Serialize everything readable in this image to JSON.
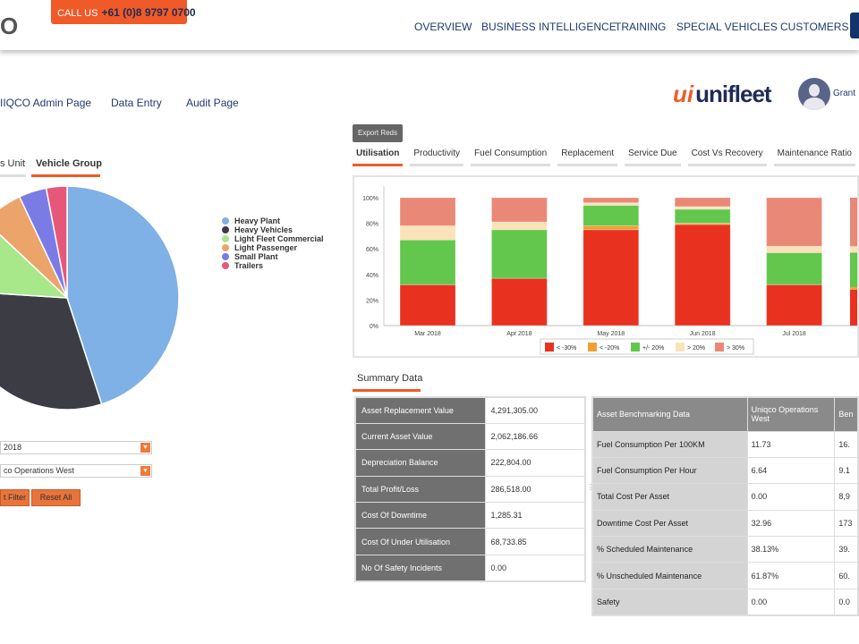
{
  "header": {
    "logo": "O",
    "call_label": "CALL US",
    "phone": "+61 (0)8 9797 0700",
    "nav": [
      "OVERVIEW",
      "BUSINESS INTELLIGENCE",
      "TRAINING",
      "SPECIAL VEHICLES",
      "CUSTOMERS"
    ]
  },
  "sublinks": [
    "IIQCO Admin Page",
    "Data Entry",
    "Audit Page"
  ],
  "brand": {
    "logo": "unifleet",
    "user": "Grant"
  },
  "left_tabs": [
    {
      "label": "s Unit",
      "active": false
    },
    {
      "label": "Vehicle Group",
      "active": true
    }
  ],
  "pie": {
    "type": "pie",
    "slices": [
      {
        "label": "Heavy Plant",
        "value": 45,
        "color": "#7fb0e6"
      },
      {
        "label": "Heavy Vehicles",
        "value": 31,
        "color": "#3c3c44"
      },
      {
        "label": "Light Fleet Commercial",
        "value": 11,
        "color": "#a8e88a"
      },
      {
        "label": "Light Passenger",
        "value": 6,
        "color": "#eca46a"
      },
      {
        "label": "Small Plant",
        "value": 4,
        "color": "#7b7be6"
      },
      {
        "label": "Trailers",
        "value": 3,
        "color": "#e6587a"
      }
    ]
  },
  "filters": {
    "date_value": "2018",
    "group_value": "co Operations West",
    "apply_label": "t Filter",
    "reset_label": "Reset All"
  },
  "export_label": "Export Reds",
  "chart_tabs": [
    {
      "label": "Utilisation",
      "active": true
    },
    {
      "label": "Productivity"
    },
    {
      "label": "Fuel Consumption"
    },
    {
      "label": "Replacement"
    },
    {
      "label": "Service Due"
    },
    {
      "label": "Cost Vs Recovery"
    },
    {
      "label": "Maintenance Ratio"
    }
  ],
  "chart_data": {
    "type": "bar",
    "stacked": true,
    "categories": [
      "Mar 2018",
      "Apr 2018",
      "May 2018",
      "Jun 2018",
      "Jul 2018"
    ],
    "ylim": [
      0,
      100
    ],
    "yticks": [
      "0%",
      "20%",
      "40%",
      "60%",
      "80%",
      "100%"
    ],
    "legend_position": "bottom",
    "series": [
      {
        "name": "< -30%",
        "color": "#e8321f",
        "values": [
          32,
          37,
          75,
          79,
          32
        ]
      },
      {
        "name": "< -20%",
        "color": "#f0a030",
        "values": [
          0,
          0,
          3,
          1,
          0
        ]
      },
      {
        "name": "+/- 20%",
        "color": "#62c74c",
        "values": [
          35,
          38,
          16,
          11,
          25
        ]
      },
      {
        "name": "> 20%",
        "color": "#fbe2b8",
        "values": [
          11,
          6,
          2,
          2,
          5
        ]
      },
      {
        "name": "> 30%",
        "color": "#ea8878",
        "values": [
          22,
          19,
          4,
          7,
          38
        ]
      }
    ]
  },
  "summary": {
    "tab": "Summary Data",
    "rows": [
      [
        "Asset Replacement Value",
        "4,291,305.00"
      ],
      [
        "Current Asset Value",
        "2,062,186.66"
      ],
      [
        "Depreciation Balance",
        "222,804.00"
      ],
      [
        "Total Profit/Loss",
        "286,518.00"
      ],
      [
        "Cost Of Downtime",
        "1,285.31"
      ],
      [
        "Cost Of Under Utilisation",
        "68,733.85"
      ],
      [
        "No Of Safety Incidents",
        "0.00"
      ]
    ]
  },
  "bench": {
    "headers": [
      "Asset Benchmarking Data",
      "Uniqco Operations West",
      "Ben"
    ],
    "rows": [
      [
        "Fuel Consumption Per 100KM",
        "11.73",
        "16."
      ],
      [
        "Fuel Consumption Per Hour",
        "6.64",
        "9.1"
      ],
      [
        "Total Cost Per Asset",
        "0.00",
        "8,9"
      ],
      [
        "Downtime Cost Per Asset",
        "32.96",
        "173"
      ],
      [
        "% Scheduled Maintenance",
        "38.13%",
        "39."
      ],
      [
        "% Unscheduled Maintenance",
        "61.87%",
        "60."
      ],
      [
        "Safety",
        "0.00",
        "0.0"
      ]
    ]
  }
}
